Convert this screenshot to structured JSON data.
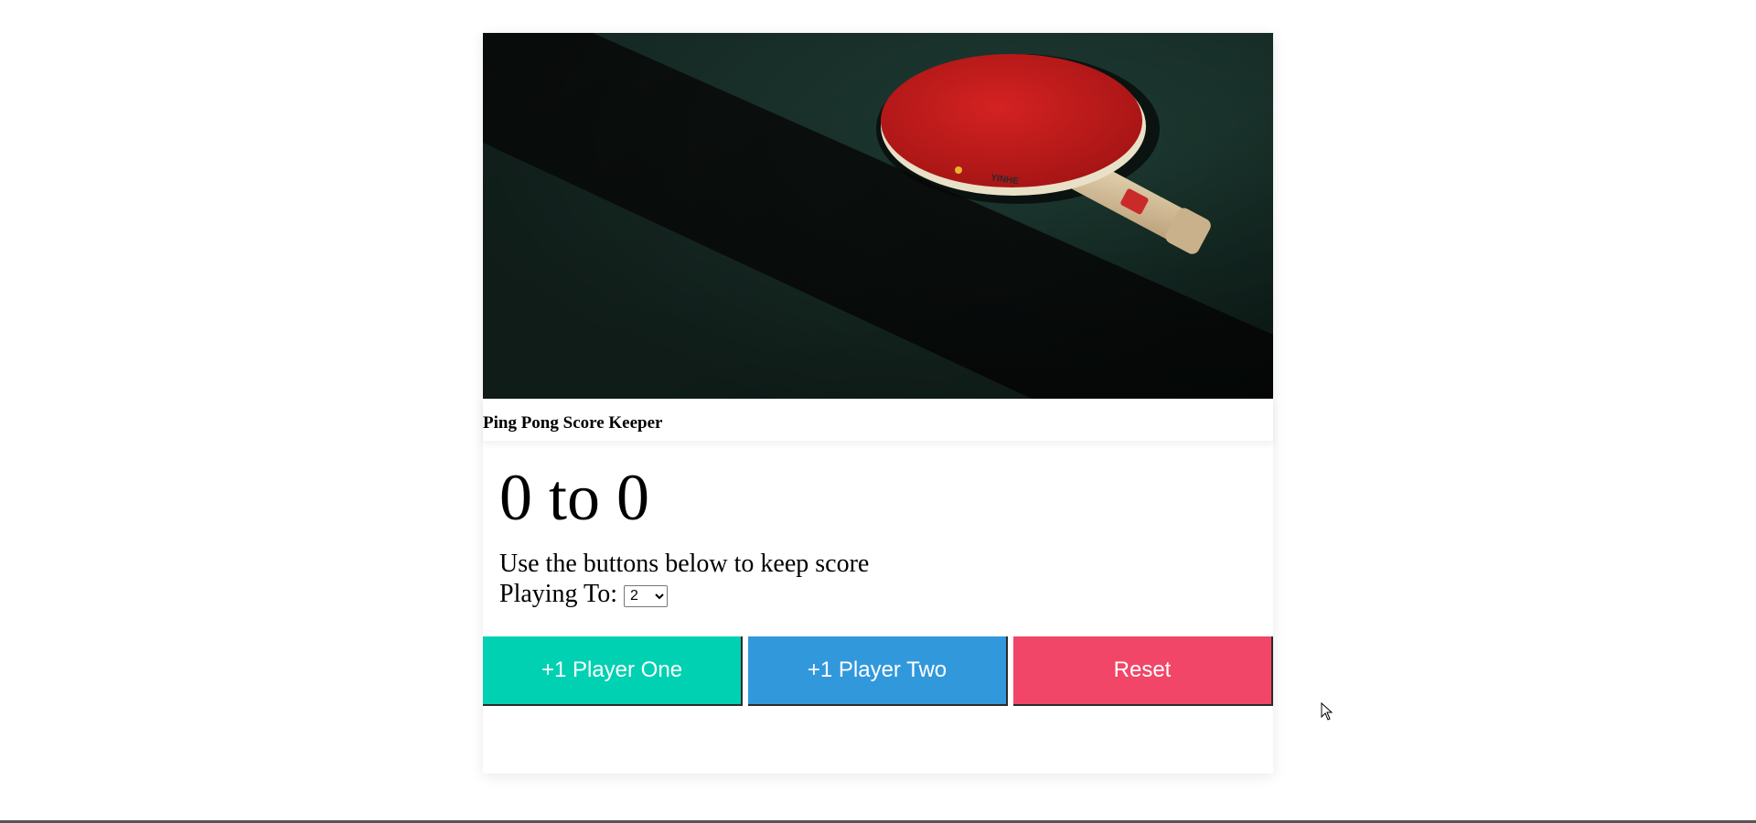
{
  "card": {
    "image": {
      "description_icon": "ping-pong-paddle-icon",
      "brand_text": "YINHE",
      "colors": {
        "table": "#1f3a32",
        "shadow": "#0b0f0d",
        "paddle_rubber": "#c51d1d",
        "handle": "#d8c8a8"
      }
    },
    "title": "Ping Pong Score Keeper",
    "score": {
      "player_one": 0,
      "player_two": 0,
      "separator": "to",
      "text": "0 to 0"
    },
    "instructions": "Use the buttons below to keep score",
    "playing_to": {
      "label": "Playing To:",
      "selected": "2"
    },
    "buttons": {
      "player_one": "+1 Player One",
      "player_two": "+1 Player Two",
      "reset": "Reset"
    }
  },
  "colors": {
    "player_one": "#00d1b2",
    "player_two": "#3298dc",
    "reset": "#f14668"
  }
}
